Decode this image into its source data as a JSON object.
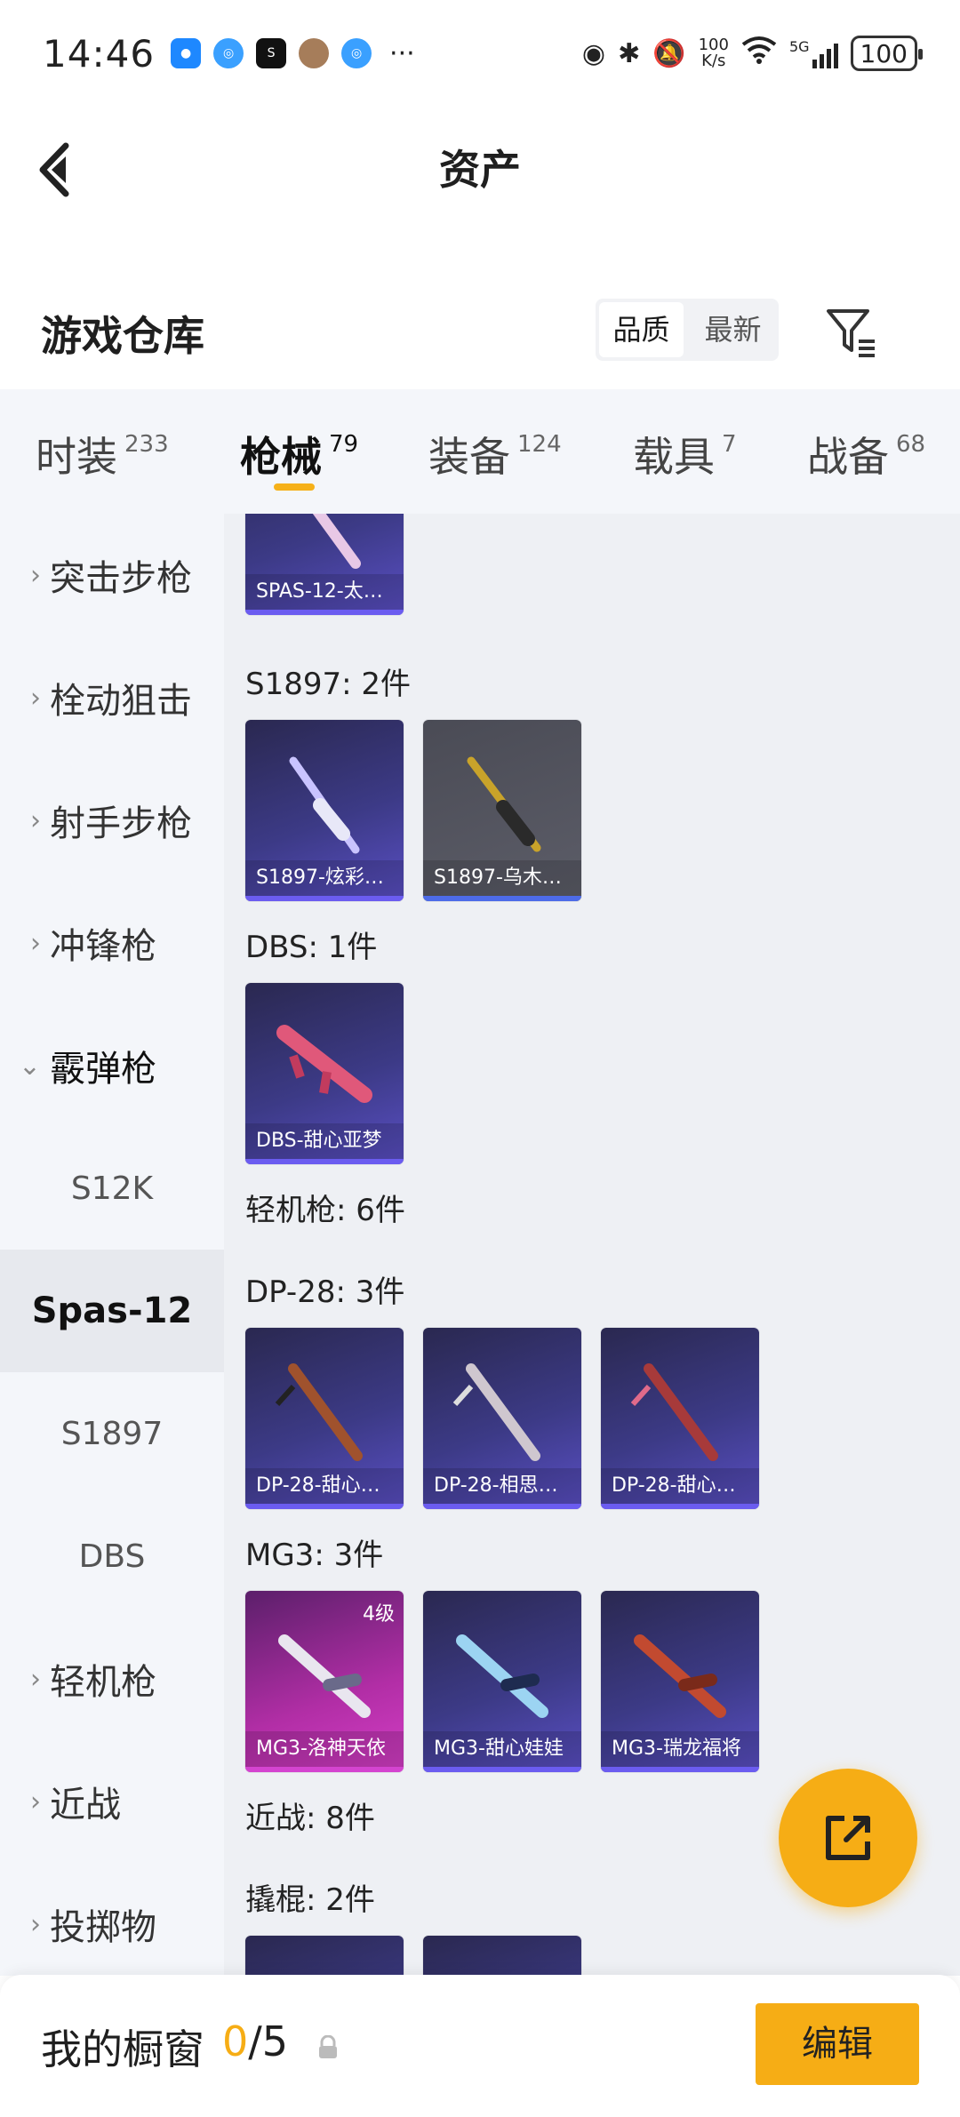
{
  "status_bar": {
    "time": "14:46",
    "net_speed_value": "100",
    "net_speed_unit": "K/s",
    "network": "5G",
    "battery": "100"
  },
  "header": {
    "title": "资产"
  },
  "section": {
    "title": "游戏仓库",
    "sort_options": [
      "品质",
      "最新"
    ],
    "sort_selected": "品质"
  },
  "tabs": [
    {
      "label": "时装",
      "count": "233"
    },
    {
      "label": "枪械",
      "count": "79",
      "active": true
    },
    {
      "label": "装备",
      "count": "124"
    },
    {
      "label": "载具",
      "count": "7"
    },
    {
      "label": "战备",
      "count": "68"
    }
  ],
  "sidebar": [
    {
      "label": "突击步枪"
    },
    {
      "label": "栓动狙击"
    },
    {
      "label": "射手步枪"
    },
    {
      "label": "冲锋枪"
    },
    {
      "label": "霰弹枪",
      "expanded": true
    },
    {
      "label": "S12K"
    },
    {
      "label": "Spas-12",
      "selected": true
    },
    {
      "label": "S1897"
    },
    {
      "label": "DBS"
    },
    {
      "label": "轻机枪"
    },
    {
      "label": "近战"
    },
    {
      "label": "投掷物"
    }
  ],
  "content": {
    "spas_card": "SPAS-12-太…",
    "s1897_label": "S1897: 2件",
    "s1897_cards": [
      "S1897-炫彩…",
      "S1897-乌木…"
    ],
    "dbs_label": "DBS: 1件",
    "dbs_cards": [
      "DBS-甜心亚梦"
    ],
    "lmg_label": "轻机枪: 6件",
    "dp28_label": "DP-28: 3件",
    "dp28_cards": [
      "DP-28-甜心…",
      "DP-28-相思…",
      "DP-28-甜心…"
    ],
    "mg3_label": "MG3: 3件",
    "mg3_cards": [
      "MG3-洛神天依",
      "MG3-甜心娃娃",
      "MG3-瑞龙福将"
    ],
    "mg3_level": "4级",
    "melee_label": "近战: 8件",
    "crowbar_label": "撬棍: 2件"
  },
  "bottom": {
    "label": "我的橱窗",
    "current": "0",
    "total": "/5",
    "edit_label": "编辑"
  },
  "colors": {
    "accent": "#f6ad15",
    "card_purple": "#3c3a86",
    "card_pink": "#b22ea6"
  }
}
